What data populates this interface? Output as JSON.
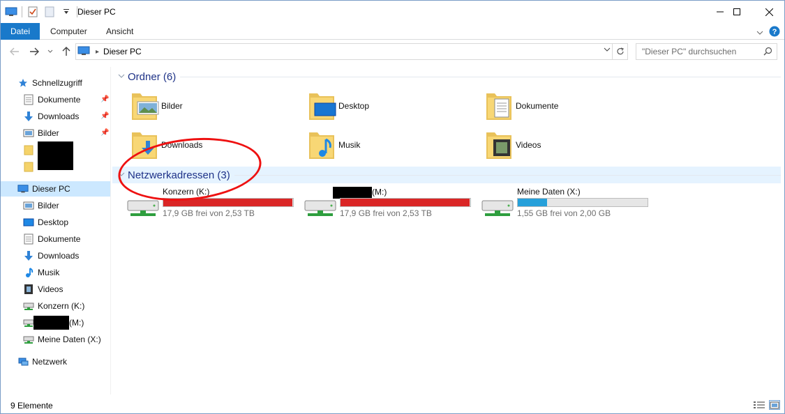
{
  "window": {
    "title": "Dieser PC",
    "qat_icons": [
      "computer-icon",
      "properties-icon",
      "new-folder-icon",
      "customize-chevron-icon"
    ]
  },
  "ribbon": {
    "tabs": [
      {
        "label": "Datei"
      },
      {
        "label": "Computer"
      },
      {
        "label": "Ansicht"
      }
    ]
  },
  "address": {
    "crumb": "Dieser PC",
    "search_placeholder": "\"Dieser PC\" durchsuchen"
  },
  "nav": {
    "quick_access": "Schnellzugriff",
    "quick_items": [
      {
        "label": "Dokumente",
        "icon": "documents-icon"
      },
      {
        "label": "Downloads",
        "icon": "downloads-icon"
      },
      {
        "label": "Bilder",
        "icon": "pictures-icon"
      }
    ],
    "this_pc": "Dieser PC",
    "pc_items": [
      {
        "label": "Bilder",
        "icon": "pictures-icon"
      },
      {
        "label": "Desktop",
        "icon": "desktop-icon"
      },
      {
        "label": "Dokumente",
        "icon": "documents-icon"
      },
      {
        "label": "Downloads",
        "icon": "downloads-icon"
      },
      {
        "label": "Musik",
        "icon": "music-icon"
      },
      {
        "label": "Videos",
        "icon": "videos-icon"
      },
      {
        "label": "Konzern (K:)",
        "icon": "network-drive-icon"
      },
      {
        "label": "(M:)",
        "icon": "network-drive-icon"
      },
      {
        "label": "Meine Daten (X:)",
        "icon": "network-drive-icon"
      }
    ],
    "network": "Netzwerk"
  },
  "content": {
    "folders_header": "Ordner (6)",
    "folders": [
      {
        "label": "Bilder",
        "icon": "pictures-folder-icon"
      },
      {
        "label": "Desktop",
        "icon": "desktop-folder-icon"
      },
      {
        "label": "Dokumente",
        "icon": "documents-folder-icon"
      },
      {
        "label": "Downloads",
        "icon": "downloads-folder-icon"
      },
      {
        "label": "Musik",
        "icon": "music-folder-icon"
      },
      {
        "label": "Videos",
        "icon": "videos-folder-icon"
      }
    ],
    "network_header": "Netzwerkadressen (3)",
    "drives": [
      {
        "name": "Konzern (K:)",
        "free": "17,9 GB frei von 2,53 TB",
        "used_fraction": 0.993,
        "bar_color": "#da2626"
      },
      {
        "name": "(M:)",
        "free": "17,9 GB frei von 2,53 TB",
        "used_fraction": 0.993,
        "bar_color": "#da2626"
      },
      {
        "name": "Meine Daten (X:)",
        "free": "1,55 GB frei von 2,00 GB",
        "used_fraction": 0.225,
        "bar_color": "#26a0da"
      }
    ]
  },
  "status": {
    "count": "9 Elemente"
  },
  "colors": {
    "accent": "#1979ca",
    "group_title": "#1e3287",
    "selection": "#cce8ff",
    "annotation": "#ee1111"
  }
}
